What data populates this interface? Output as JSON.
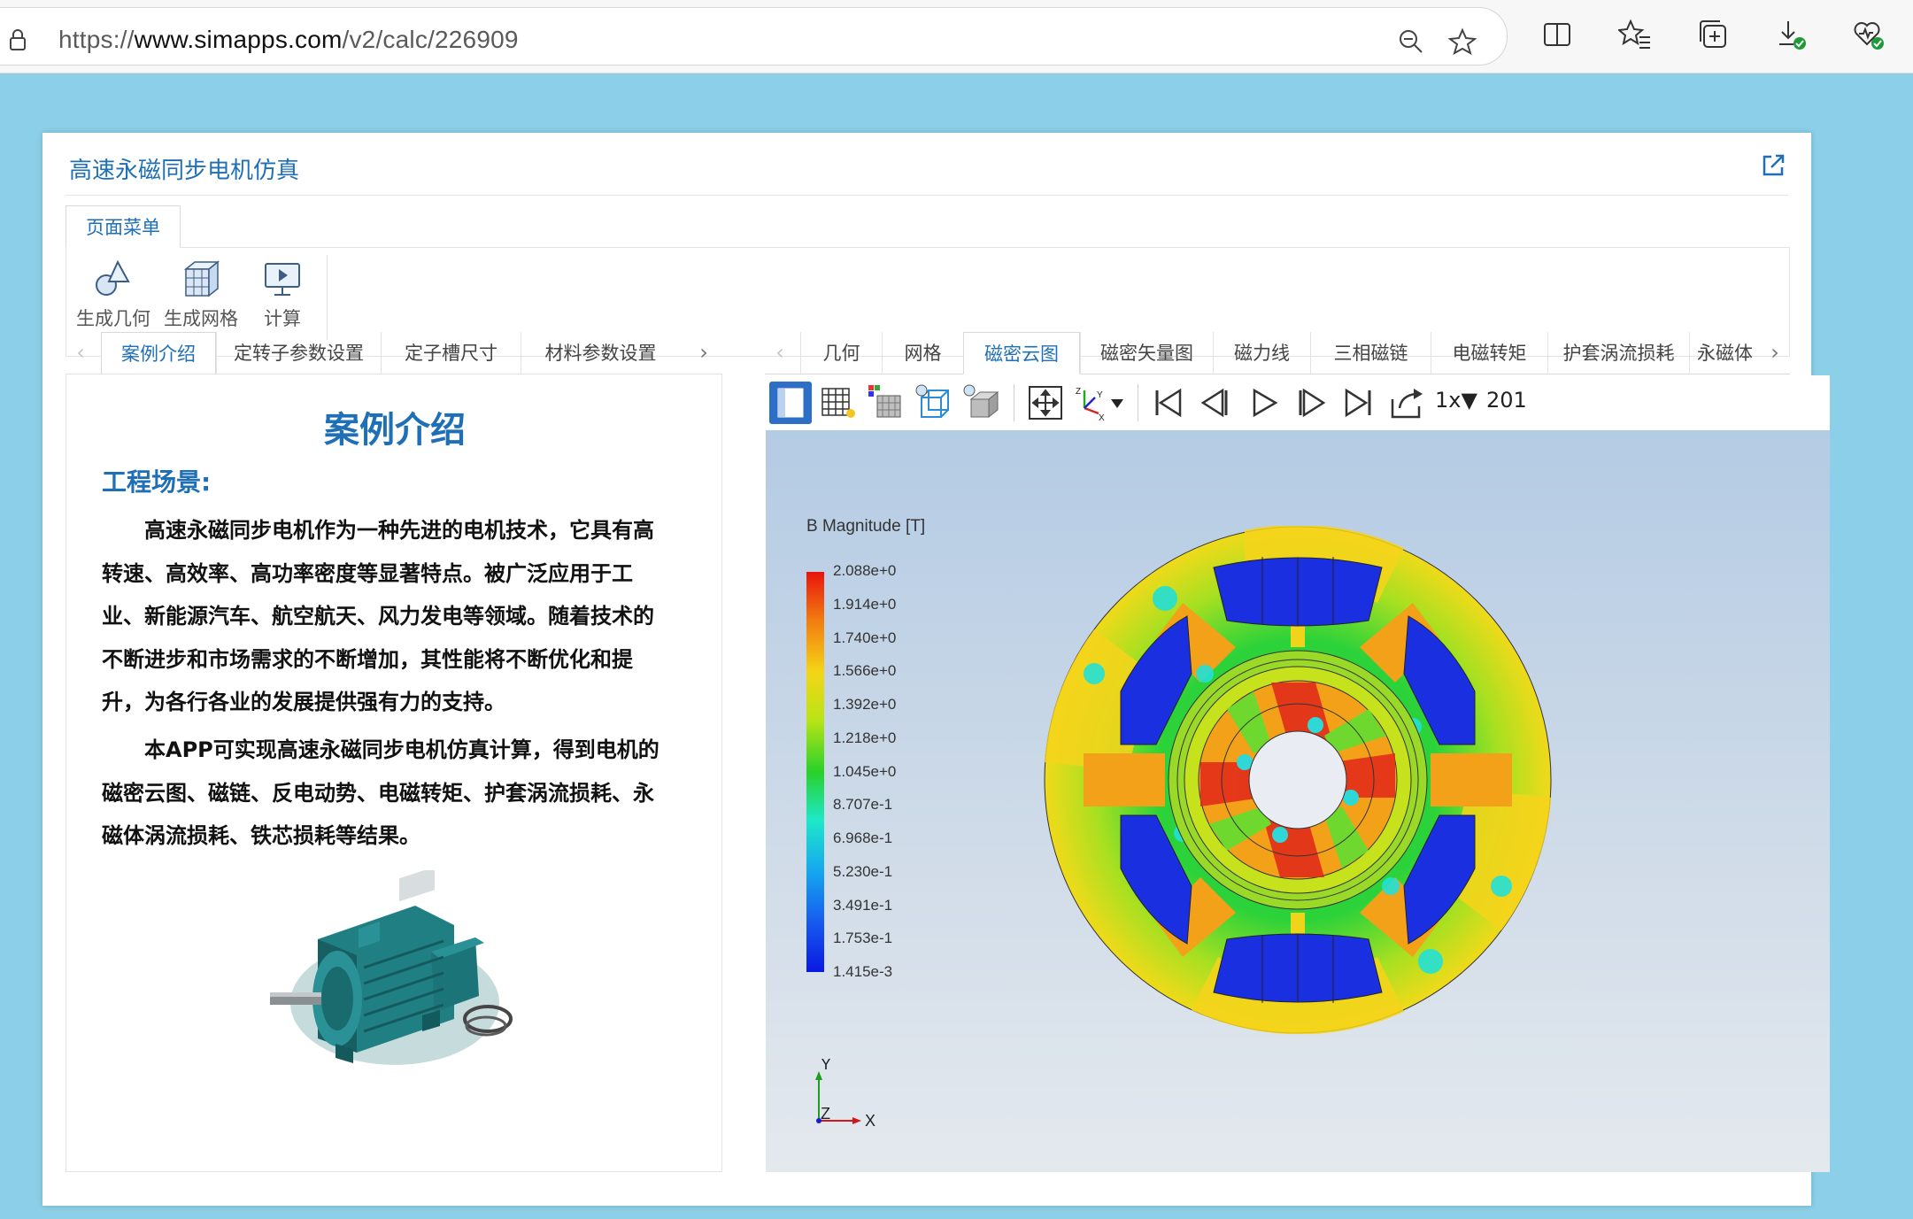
{
  "browser": {
    "url_prefix": "https://",
    "url_host": "www.simapps.com",
    "url_path": "/v2/calc/226909"
  },
  "app": {
    "title": "高速永磁同步电机仿真"
  },
  "menu": {
    "tab_label": "页面菜单",
    "tools": [
      {
        "label": "生成几何",
        "icon": "geometry-icon"
      },
      {
        "label": "生成网格",
        "icon": "mesh-icon"
      },
      {
        "label": "计算",
        "icon": "compute-icon"
      }
    ]
  },
  "left_tabs": [
    "案例介绍",
    "定转子参数设置",
    "定子槽尺寸",
    "材料参数设置"
  ],
  "left_active_tab": "案例介绍",
  "right_tabs": [
    "几何",
    "网格",
    "磁密云图",
    "磁密矢量图",
    "磁力线",
    "三相磁链",
    "电磁转矩",
    "护套涡流损耗",
    "永磁体"
  ],
  "right_active_tab": "磁密云图",
  "case": {
    "heading": "案例介绍",
    "scene_title": "工程场景:",
    "paragraph1": "高速永磁同步电机作为一种先进的电机技术，它具有高转速、高效率、高功率密度等显著特点。被广泛应用于工业、新能源汽车、航空航天、风力发电等领域。随着技术的不断进步和市场需求的不断增加，其性能将不断优化和提升，为各行各业的发展提供强有力的支持。",
    "paragraph2": "本APP可实现高速永磁同步电机仿真计算，得到电机的磁密云图、磁链、反电动势、电磁转矩、护套涡流损耗、永磁体涡流损耗、铁芯损耗等结果。"
  },
  "viewer": {
    "speed": "1x▼",
    "frame": "201",
    "legend_title": "B Magnitude [T]",
    "legend_values": [
      "2.088e+0",
      "1.914e+0",
      "1.740e+0",
      "1.566e+0",
      "1.392e+0",
      "1.218e+0",
      "1.045e+0",
      "8.707e-1",
      "6.968e-1",
      "5.230e-1",
      "3.491e-1",
      "1.753e-1",
      "1.415e-3"
    ],
    "axis_y": "Y",
    "axis_x": "X",
    "axis_z": "Z"
  },
  "colors": {
    "accent": "#1e6fb6",
    "page_bg": "#8ccfe8",
    "toolbar_selected": "#2d6fc7"
  }
}
